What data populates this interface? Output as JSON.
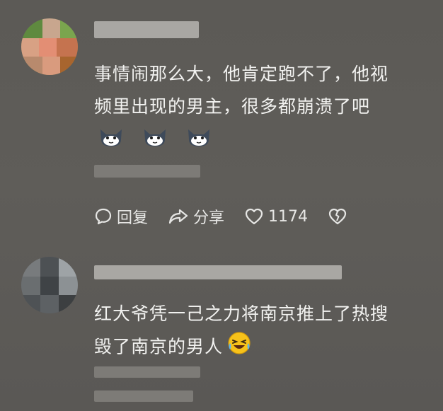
{
  "comments": [
    {
      "text_lines": [
        "事情闹那么大，他肯定跑不了，他视",
        "频里出现的男主，很多都崩溃了吧"
      ],
      "emoji_count": 3,
      "emoji_icon": "cat-face-icon",
      "actions": {
        "reply_label": "回复",
        "share_label": "分享",
        "like_count": "1174"
      }
    },
    {
      "text_lines": [
        "红大爷凭一己之力将南京推上了热搜",
        "毁了南京的男人"
      ],
      "trailing_emoji_icon": "laughing-crying-icon"
    }
  ],
  "colors": {
    "background": "#5e5c58",
    "text": "#f2f2f0",
    "emoji_yellow": "#f7c21a"
  }
}
